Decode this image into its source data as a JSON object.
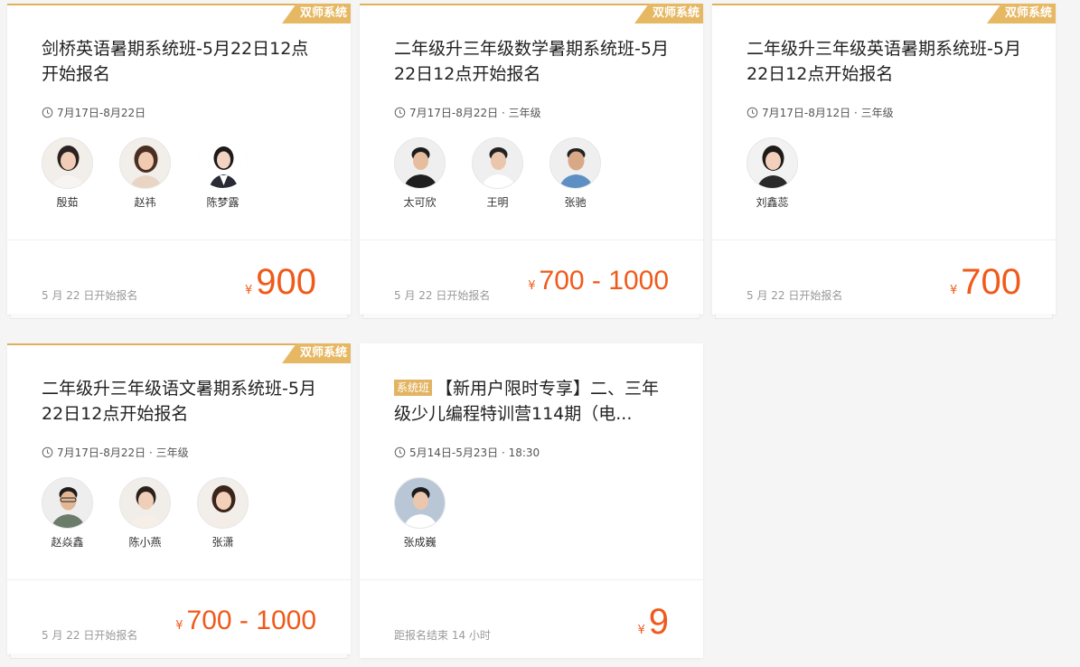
{
  "cards": [
    {
      "badge": "双师系统",
      "title": "剑桥英语暑期系统班-5月22日12点开始报名",
      "meta": "7月17日-8月22日",
      "teachers": [
        "殷茹",
        "赵祎",
        "陈梦露"
      ],
      "footnote": "5 月 22 日开始报名",
      "currency": "¥",
      "price": "900"
    },
    {
      "badge": "双师系统",
      "title": "二年级升三年级数学暑期系统班-5月22日12点开始报名",
      "meta": "7月17日-8月22日 · 三年级",
      "teachers": [
        "太可欣",
        "王明",
        "张驰"
      ],
      "footnote": "5 月 22 日开始报名",
      "currency": "¥",
      "price": "700 - 1000"
    },
    {
      "badge": "双师系统",
      "title": "二年级升三年级英语暑期系统班-5月22日12点开始报名",
      "meta": "7月17日-8月12日 · 三年级",
      "teachers": [
        "刘鑫蕊"
      ],
      "footnote": "5 月 22 日开始报名",
      "currency": "¥",
      "price": "700"
    },
    {
      "badge": "双师系统",
      "title": "二年级升三年级语文暑期系统班-5月22日12点开始报名",
      "meta": "7月17日-8月22日 · 三年级",
      "teachers": [
        "赵焱鑫",
        "陈小燕",
        "张潇"
      ],
      "footnote": "5 月 22 日开始报名",
      "currency": "¥",
      "price": "700 - 1000"
    },
    {
      "tag": "系统班",
      "title": "【新用户限时专享】二、三年级少儿编程特训营114期（电...",
      "meta": "5月14日-5月23日 · 18:30",
      "teachers": [
        "张成巍"
      ],
      "footnote": "距报名结束 14 小时",
      "currency": "¥",
      "price": "9"
    }
  ],
  "colors": {
    "accent": "#f05a1a",
    "badge": "#e6b863",
    "background": "#f5f5f5"
  },
  "icons": {
    "clock": "clock-icon",
    "avatar": "teacher-avatar-photo"
  }
}
